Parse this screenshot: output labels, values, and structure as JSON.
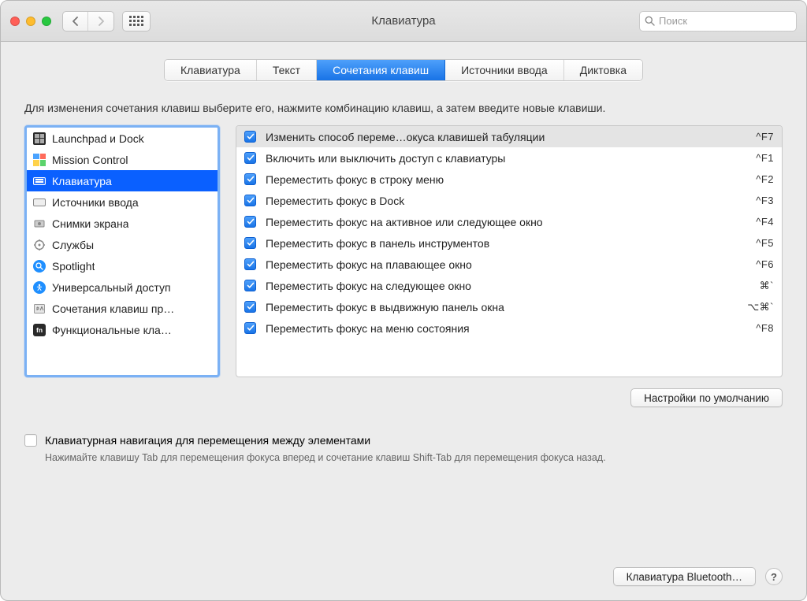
{
  "header": {
    "title": "Клавиатура",
    "search_placeholder": "Поиск"
  },
  "tabs": [
    {
      "label": "Клавиатура",
      "active": false
    },
    {
      "label": "Текст",
      "active": false
    },
    {
      "label": "Сочетания клавиш",
      "active": true
    },
    {
      "label": "Источники ввода",
      "active": false
    },
    {
      "label": "Диктовка",
      "active": false
    }
  ],
  "instruction": "Для изменения сочетания клавиш выберите его, нажмите комбинацию клавиш, а затем введите новые клавиши.",
  "categories": [
    {
      "icon": "launchpad",
      "label": "Launchpad и Dock",
      "selected": false
    },
    {
      "icon": "mission",
      "label": "Mission Control",
      "selected": false
    },
    {
      "icon": "keyboard",
      "label": "Клавиатура",
      "selected": true
    },
    {
      "icon": "input",
      "label": "Источники ввода",
      "selected": false
    },
    {
      "icon": "screenshot",
      "label": "Снимки экрана",
      "selected": false
    },
    {
      "icon": "services",
      "label": "Службы",
      "selected": false
    },
    {
      "icon": "spotlight",
      "label": "Spotlight",
      "selected": false
    },
    {
      "icon": "access",
      "label": "Универсальный доступ",
      "selected": false
    },
    {
      "icon": "appshort",
      "label": "Сочетания клавиш пр…",
      "selected": false
    },
    {
      "icon": "fn",
      "label": "Функциональные кла…",
      "selected": false
    }
  ],
  "shortcuts": [
    {
      "checked": true,
      "label": "Изменить способ переме…окуса клавишей табуляции",
      "key": "^F7",
      "selected": true
    },
    {
      "checked": true,
      "label": "Включить или выключить доступ с клавиатуры",
      "key": "^F1",
      "selected": false
    },
    {
      "checked": true,
      "label": "Переместить фокус в строку меню",
      "key": "^F2",
      "selected": false
    },
    {
      "checked": true,
      "label": "Переместить фокус в Dock",
      "key": "^F3",
      "selected": false
    },
    {
      "checked": true,
      "label": "Переместить фокус на активное или следующее окно",
      "key": "^F4",
      "selected": false
    },
    {
      "checked": true,
      "label": "Переместить фокус в панель инструментов",
      "key": "^F5",
      "selected": false
    },
    {
      "checked": true,
      "label": "Переместить фокус на плавающее окно",
      "key": "^F6",
      "selected": false
    },
    {
      "checked": true,
      "label": "Переместить фокус на следующее окно",
      "key": "⌘`",
      "selected": false
    },
    {
      "checked": true,
      "label": "Переместить фокус в выдвижную панель окна",
      "key": "⌥⌘`",
      "selected": false
    },
    {
      "checked": true,
      "label": "Переместить фокус на меню состояния",
      "key": "^F8",
      "selected": false
    }
  ],
  "defaults_button": "Настройки по умолчанию",
  "kb_nav_checkbox_label": "Клавиатурная навигация для перемещения между элементами",
  "kb_nav_hint": "Нажимайте клавишу Tab для перемещения фокуса вперед и сочетание клавиш Shift-Tab для перемещения фокуса назад.",
  "bluetooth_button": "Клавиатура Bluetooth…",
  "help_label": "?"
}
